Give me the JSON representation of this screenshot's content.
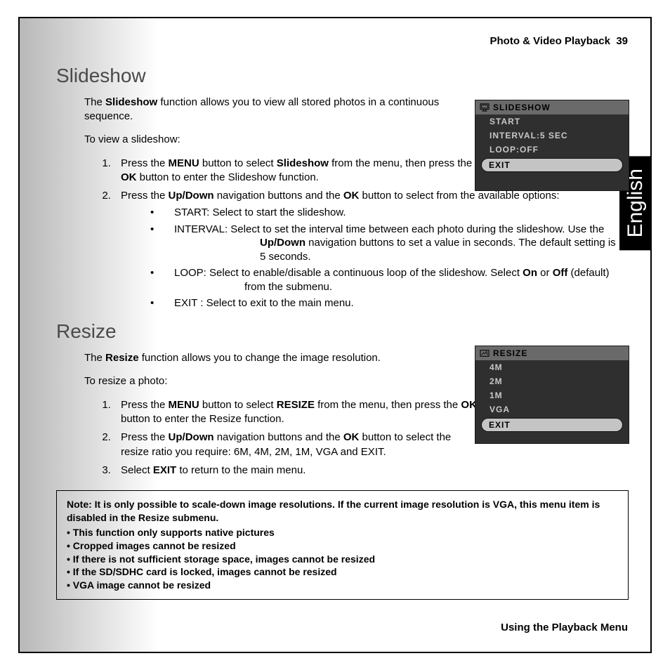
{
  "header": {
    "section": "Photo & Video Playback",
    "page": "39"
  },
  "lang": "English",
  "footer": "Using the Playback Menu",
  "sec1": {
    "title": "Slideshow",
    "intro_a": "The ",
    "intro_b": "Slideshow",
    "intro_c": " function allows you to view all stored photos in a continuous sequence.",
    "lead": "To view a slideshow:",
    "li1_a": "Press the ",
    "li1_b": "MENU",
    "li1_c": " button to select ",
    "li1_d": "Slideshow",
    "li1_e": " from the menu, then press the ",
    "li1_f": "OK",
    "li1_g": " button to enter the Slideshow function.",
    "li2_a": "Press the ",
    "li2_b": "Up/Down",
    "li2_c": " navigation buttons and the ",
    "li2_d": "OK",
    "li2_e": " button to select from the available options:",
    "s_start": "START: Select to start the slideshow.",
    "s_int_a": "INTERVAL: Select to set the interval time between each photo during the slideshow. Use the ",
    "s_int_b": "Up/Down",
    "s_int_c": " navigation buttons to set a value in seconds. The default setting is 5 seconds.",
    "s_loop_a": "LOOP: Select to enable/disable a continuous loop of the slideshow. Select ",
    "s_loop_b": "On",
    "s_loop_c": " or ",
    "s_loop_d": "Off",
    "s_loop_e": " (default) from the submenu.",
    "s_exit": "EXIT : Select to exit to the main menu."
  },
  "sec2": {
    "title": "Resize",
    "intro_a": "The ",
    "intro_b": "Resize",
    "intro_c": " function allows you to change the image resolution.",
    "lead": "To resize a photo:",
    "li1_a": "Press the ",
    "li1_b": "MENU",
    "li1_c": " button to select ",
    "li1_d": "RESIZE",
    "li1_e": " from the menu, then press the ",
    "li1_f": "OK",
    "li1_g": " button to enter the Resize function.",
    "li2_a": "Press the ",
    "li2_b": "Up/Down",
    "li2_c": " navigation buttons and the ",
    "li2_d": "OK",
    "li2_e": " button to select the resize ratio you require: 6M, 4M, 2M, 1M, VGA and EXIT.",
    "li3_a": "Select ",
    "li3_b": "EXIT",
    "li3_c": " to return to the main menu."
  },
  "note": {
    "head": "Note: It is only possible to scale-down image resolutions. If the current image resolution is VGA, this menu item is disabled in the Resize submenu.",
    "b1": "This function only supports native pictures",
    "b2": "Cropped images cannot be resized",
    "b3": "If there is not sufficient storage space, images cannot be resized",
    "b4": "If the SD/SDHC card is locked, images cannot be resized",
    "b5": "VGA image cannot be resized"
  },
  "osd1": {
    "title": "SLIDESHOW",
    "r1": "START",
    "r2": "INTERVAL:5 SEC",
    "r3": "LOOP:OFF",
    "r4": "EXIT"
  },
  "osd2": {
    "title": "RESIZE",
    "r1": "4M",
    "r2": "2M",
    "r3": "1M",
    "r4": "VGA",
    "r5": "EXIT"
  }
}
